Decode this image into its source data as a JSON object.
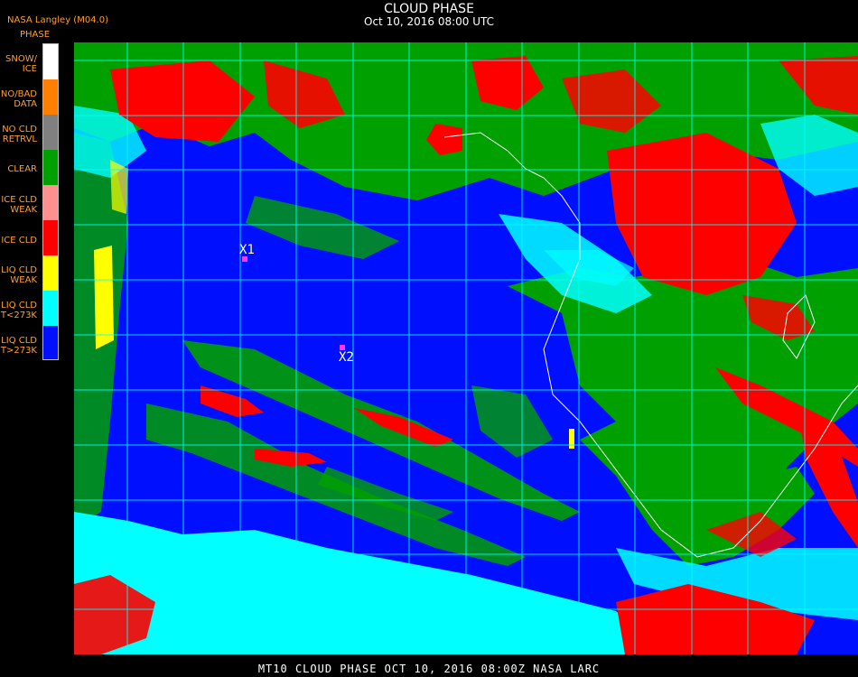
{
  "header": {
    "title": "CLOUD PHASE",
    "subtitle": "Oct 10, 2016 08:00 UTC"
  },
  "product": {
    "name": "NASA Langley (M04.0)"
  },
  "legend": {
    "title": "PHASE",
    "items": [
      {
        "label": "SNOW/\nICE",
        "color": "#ffffff"
      },
      {
        "label": "NO/BAD\nDATA",
        "color": "#ff8000"
      },
      {
        "label": "NO CLD\nRETRVL",
        "color": "#808080"
      },
      {
        "label": "CLEAR",
        "color": "#00a000"
      },
      {
        "label": "ICE CLD\nWEAK",
        "color": "#ff9090"
      },
      {
        "label": "ICE CLD",
        "color": "#ff0000"
      },
      {
        "label": "LIQ CLD\nWEAK",
        "color": "#ffff00"
      },
      {
        "label": "LIQ CLD\nT<273K",
        "color": "#00ffff"
      },
      {
        "label": "LIQ CLD\nT>273K",
        "color": "#0010ff"
      }
    ]
  },
  "map": {
    "grid_color": "#00ffff",
    "markers": [
      {
        "label": "X1"
      },
      {
        "label": "X2"
      }
    ]
  },
  "footer": {
    "text": "MT10  CLOUD PHASE  OCT 10, 2016 08:00Z  NASA LARC"
  }
}
